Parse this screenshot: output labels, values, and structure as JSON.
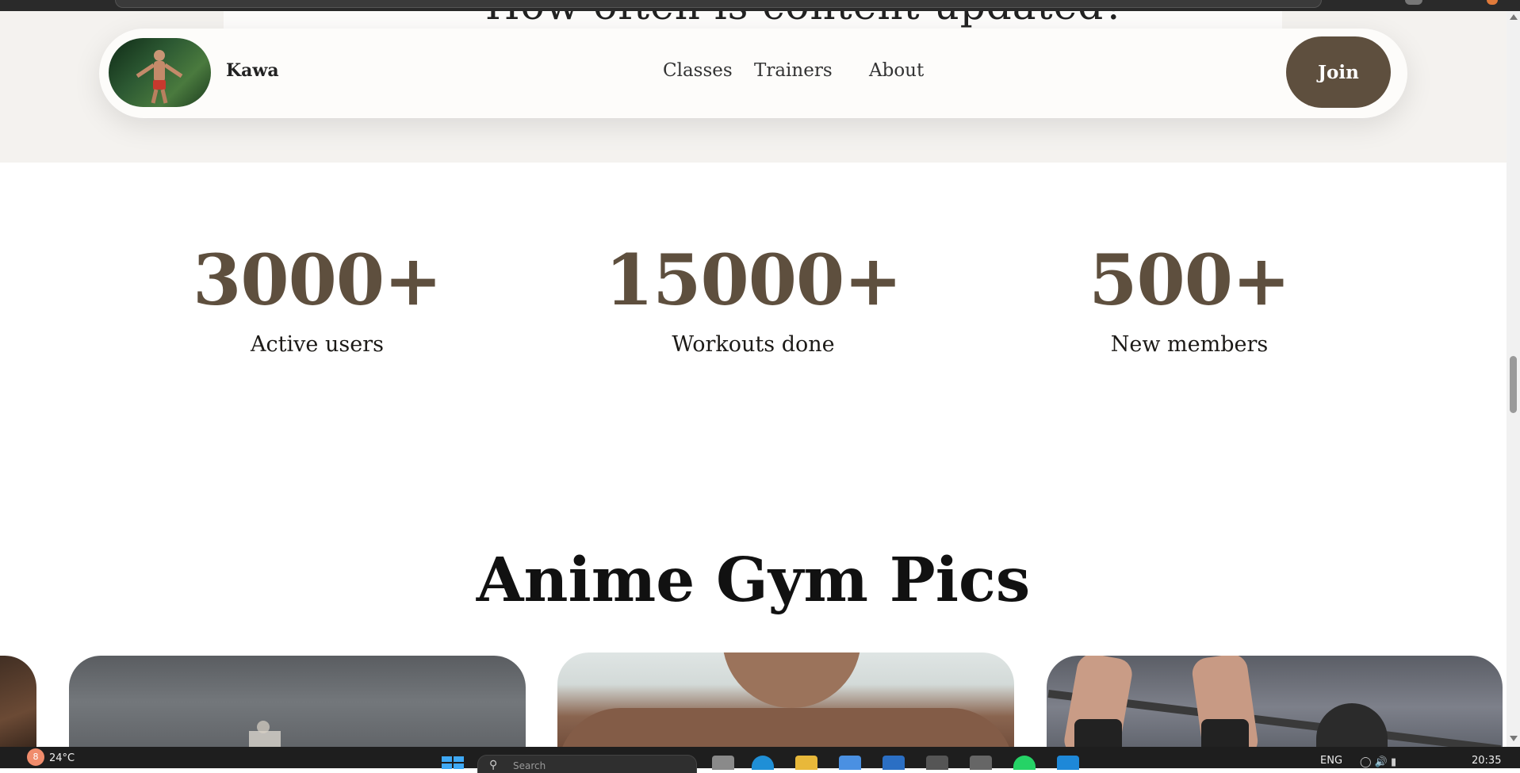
{
  "previous_section": {
    "question_text": "How often is content updated?"
  },
  "navbar": {
    "brand": "Kawa",
    "links": [
      "Classes",
      "Trainers",
      "About"
    ],
    "join_label": "Join"
  },
  "stats": [
    {
      "value": "3000+",
      "label": "Active users"
    },
    {
      "value": "15000+",
      "label": "Workouts done"
    },
    {
      "value": "500+",
      "label": "New members"
    }
  ],
  "gallery": {
    "title": "Anime Gym Pics"
  },
  "taskbar": {
    "notification_count": "8",
    "temperature": "24°C",
    "search_placeholder": "Search",
    "language": "ENG",
    "time": "20:35"
  },
  "colors": {
    "accent_brown": "#5e4f3e",
    "header_band": "#f4f2ef",
    "navbar_bg": "#fdfcfa"
  }
}
